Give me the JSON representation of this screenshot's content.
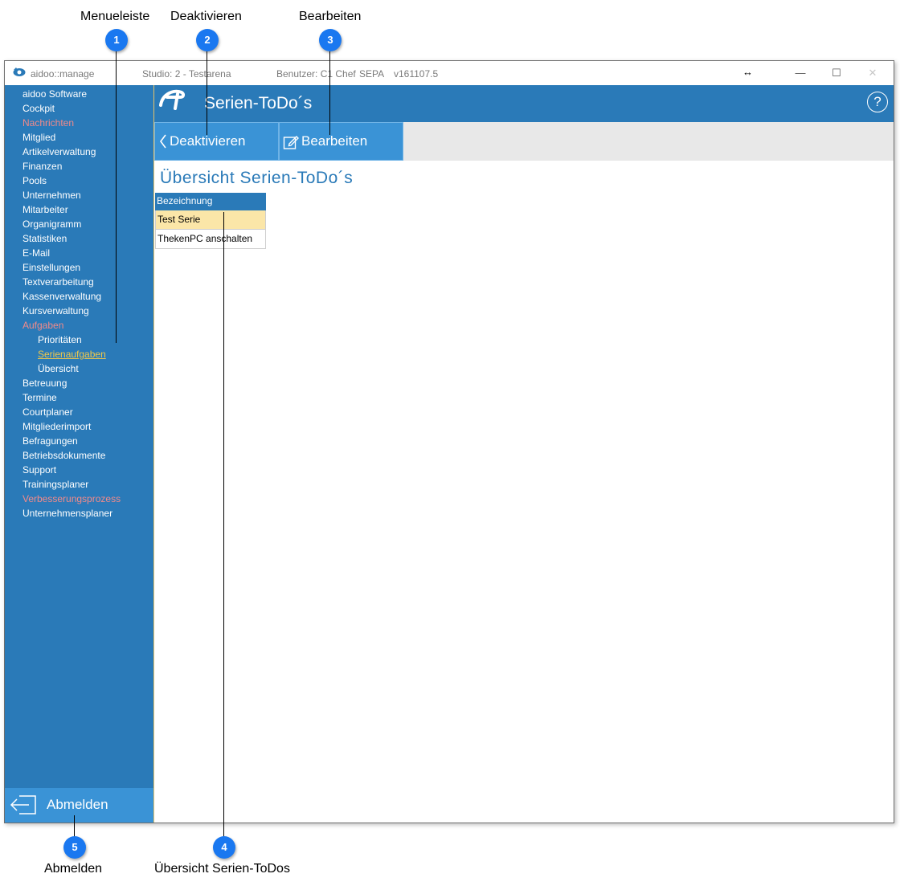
{
  "callouts": {
    "top": [
      {
        "number": "1",
        "label": "Menueleiste"
      },
      {
        "number": "2",
        "label": "Deaktivieren"
      },
      {
        "number": "3",
        "label": "Bearbeiten"
      }
    ],
    "bottom": [
      {
        "number": "5",
        "label": "Abmelden"
      },
      {
        "number": "4",
        "label": "Übersicht Serien-ToDos"
      }
    ]
  },
  "titlebar": {
    "app": "aidoo::manage",
    "studio": "Studio: 2 - Testarena",
    "user": "Benutzer: C1 Chef",
    "sepa": "SEPA",
    "version": "v161107.5",
    "resize_glyph": "↔",
    "minimize": "—",
    "maximize": "☐",
    "close": "✕"
  },
  "sidebar": {
    "items": [
      {
        "label": "aidoo Software"
      },
      {
        "label": "Cockpit"
      },
      {
        "label": "Nachrichten",
        "style": "red"
      },
      {
        "label": "Mitglied"
      },
      {
        "label": "Artikelverwaltung"
      },
      {
        "label": "Finanzen"
      },
      {
        "label": "Pools"
      },
      {
        "label": "Unternehmen"
      },
      {
        "label": "Mitarbeiter"
      },
      {
        "label": "Organigramm"
      },
      {
        "label": "Statistiken"
      },
      {
        "label": "E-Mail"
      },
      {
        "label": "Einstellungen"
      },
      {
        "label": "Textverarbeitung"
      },
      {
        "label": "Kassenverwaltung"
      },
      {
        "label": "Kursverwaltung"
      },
      {
        "label": "Aufgaben",
        "style": "red"
      },
      {
        "label": "Prioritäten",
        "style": "sub"
      },
      {
        "label": "Serienaufgaben",
        "style": "sub active"
      },
      {
        "label": "Übersicht",
        "style": "sub"
      },
      {
        "label": "Betreuung"
      },
      {
        "label": "Termine"
      },
      {
        "label": "Courtplaner"
      },
      {
        "label": "Mitgliederimport"
      },
      {
        "label": "Befragungen"
      },
      {
        "label": "Betriebsdokumente"
      },
      {
        "label": "Support"
      },
      {
        "label": "Trainingsplaner"
      },
      {
        "label": "Verbesserungsprozess",
        "style": "red"
      },
      {
        "label": "Unternehmensplaner"
      }
    ],
    "logout_label": "Abmelden"
  },
  "header": {
    "title": "Serien-ToDo´s",
    "help": "?"
  },
  "toolbar": {
    "deactivate_label": "Deaktivieren",
    "edit_label": "Bearbeiten"
  },
  "main": {
    "heading": "Übersicht Serien-ToDo´s",
    "table": {
      "column": "Bezeichnung",
      "rows": [
        "Test Serie",
        "ThekenPC anschalten"
      ]
    }
  },
  "colors": {
    "primary": "#2a7ab8",
    "button": "#3a93d6",
    "selected_row": "#fbe6a8",
    "alert_text": "#f28a8a",
    "active_link": "#f0c84a",
    "badge": "#1a78f0"
  }
}
